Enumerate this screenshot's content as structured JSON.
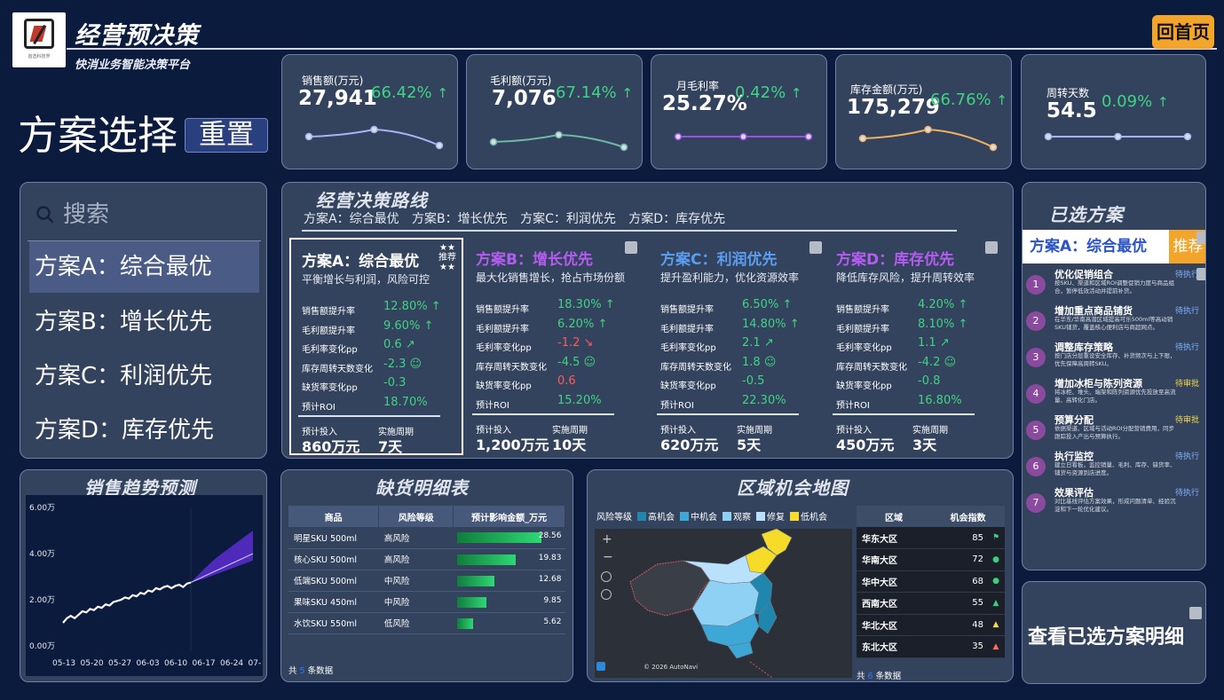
{
  "header": {
    "app_title": "经营预决策",
    "app_subtitle": "快消业务智能决策平台",
    "logo_caption": "首选科技界",
    "home_button": "回首页"
  },
  "scheme_select": {
    "title": "方案选择",
    "reset": "重置",
    "search_placeholder": "搜索",
    "items": [
      "方案A：综合最优",
      "方案B：增长优先",
      "方案C：利润优先",
      "方案D：库存优先"
    ],
    "active_index": 0
  },
  "kpis": [
    {
      "name": "销售额(万元)",
      "value": "27,941",
      "pct": "66.42%",
      "color": "#a6b4f2",
      "points": [
        0.5,
        0.7,
        0.25
      ]
    },
    {
      "name": "毛利额(万元)",
      "value": "7,076",
      "pct": "67.14%",
      "color": "#6fb8a7",
      "points": [
        0.35,
        0.55,
        0.2
      ]
    },
    {
      "name": "月毛利率",
      "value": "25.27%",
      "pct": "0.42%",
      "color": "#9d4de8",
      "points": [
        0.5,
        0.5,
        0.5
      ]
    },
    {
      "name": "库存金额(万元)",
      "value": "175,279",
      "pct": "66.76%",
      "color": "#f1b160",
      "points": [
        0.45,
        0.7,
        0.2
      ]
    },
    {
      "name": "周转天数",
      "value": "54.5",
      "pct": "0.09%",
      "color": "#a6b4f2",
      "points": [
        0.5,
        0.5,
        0.5
      ]
    }
  ],
  "route": {
    "title": "经营决策路线",
    "legend": "方案A：综合最优 方案B：增长优先 方案C：利润优先 方案D：库存优先",
    "recommend_badge": "推荐",
    "cards": [
      {
        "name": "方案A：综合最优",
        "desc": "平衡增长与利润，风险可控",
        "name_color": "#ffffff",
        "metrics": [
          {
            "label": "销售额提升率",
            "value": "12.80%",
            "icon": "↑",
            "color": "#3fd384"
          },
          {
            "label": "毛利额提升率",
            "value": "9.60%",
            "icon": "↑",
            "color": "#3fd384"
          },
          {
            "label": "毛利率变化pp",
            "value": "0.6",
            "icon": "↗",
            "color": "#3fd384"
          },
          {
            "label": "库存周转天数变化",
            "value": "-2.3",
            "icon": "☺",
            "color": "#3fd384"
          },
          {
            "label": "缺货率变化pp",
            "value": "-0.3",
            "icon": "",
            "color": "#3fd384"
          },
          {
            "label": "预计ROI",
            "value": "18.70%",
            "icon": "",
            "color": "#3fd384"
          }
        ],
        "invest_label": "预计投入",
        "invest": "860万元",
        "period_label": "实施周期",
        "period": "7天"
      },
      {
        "name": "方案B：增长优先",
        "desc": "最大化销售增长，抢占市场份额",
        "name_color": "#b45cf0",
        "metrics": [
          {
            "label": "销售额提升率",
            "value": "18.30%",
            "icon": "↑",
            "color": "#3fd384"
          },
          {
            "label": "毛利额提升率",
            "value": "6.20%",
            "icon": "↑",
            "color": "#3fd384"
          },
          {
            "label": "毛利率变化pp",
            "value": "-1.2",
            "icon": "↘",
            "color": "#ff5a5a"
          },
          {
            "label": "库存周转天数变化",
            "value": "-4.5",
            "icon": "☺",
            "color": "#3fd384"
          },
          {
            "label": "缺货率变化pp",
            "value": "0.6",
            "icon": "",
            "color": "#ff5a5a"
          },
          {
            "label": "预计ROI",
            "value": "15.20%",
            "icon": "",
            "color": "#3fd384"
          }
        ],
        "invest_label": "预计投入",
        "invest": "1,200万元",
        "period_label": "实施周期",
        "period": "10天"
      },
      {
        "name": "方案C：利润优先",
        "desc": "提升盈利能力，优化资源效率",
        "name_color": "#5a9cf0",
        "metrics": [
          {
            "label": "销售额提升率",
            "value": "6.50%",
            "icon": "↑",
            "color": "#3fd384"
          },
          {
            "label": "毛利额提升率",
            "value": "14.80%",
            "icon": "↑",
            "color": "#3fd384"
          },
          {
            "label": "毛利率变化pp",
            "value": "2.1",
            "icon": "↗",
            "color": "#3fd384"
          },
          {
            "label": "库存周转天数变化",
            "value": "1.8",
            "icon": "☺",
            "color": "#3fd384"
          },
          {
            "label": "缺货率变化pp",
            "value": "-0.5",
            "icon": "",
            "color": "#3fd384"
          },
          {
            "label": "预计ROI",
            "value": "22.30%",
            "icon": "",
            "color": "#3fd384"
          }
        ],
        "invest_label": "预计投入",
        "invest": "620万元",
        "period_label": "实施周期",
        "period": "5天"
      },
      {
        "name": "方案D：库存优先",
        "desc": "降低库存风险，提升周转效率",
        "name_color": "#b45cf0",
        "metrics": [
          {
            "label": "销售额提升率",
            "value": "4.20%",
            "icon": "↑",
            "color": "#3fd384"
          },
          {
            "label": "毛利额提升率",
            "value": "8.10%",
            "icon": "↑",
            "color": "#3fd384"
          },
          {
            "label": "毛利率变化pp",
            "value": "1.1",
            "icon": "↗",
            "color": "#3fd384"
          },
          {
            "label": "库存周转天数变化",
            "value": "-4.2",
            "icon": "☺",
            "color": "#3fd384"
          },
          {
            "label": "缺货率变化pp",
            "value": "-0.8",
            "icon": "",
            "color": "#3fd384"
          },
          {
            "label": "预计ROI",
            "value": "16.80%",
            "icon": "",
            "color": "#3fd384"
          }
        ],
        "invest_label": "预计投入",
        "invest": "450万元",
        "period_label": "实施周期",
        "period": "3天"
      }
    ]
  },
  "selected": {
    "title": "已选方案",
    "scheme": "方案A：综合最优",
    "tag": "推荐",
    "steps": [
      {
        "n": "1",
        "title": "优化促销组合",
        "desc": "按SKU、渠道和区域ROI调整促销力度与商品组合，暂停低效活动并提前补货。",
        "status": "待执行"
      },
      {
        "n": "2",
        "title": "增加重点商品铺货",
        "desc": "在华东/华南高潜区域提高可乐500ml等高动销SKU铺货，覆盖核心便利店与商超网点。",
        "status": "待执行"
      },
      {
        "n": "3",
        "title": "调整库存策略",
        "desc": "按门店分层重设安全库存、补货频次与上下限，优先保障高周转SKU。",
        "status": "待执行"
      },
      {
        "n": "4",
        "title": "增加冰柜与陈列资源",
        "desc": "将冰柜、堆头、端架和陈列资源优先投放至高流量、高转化门店。",
        "status": "待审批"
      },
      {
        "n": "5",
        "title": "预算分配",
        "desc": "依据渠道、区域与活动ROI分配营销费用，同步跟踪投入产出与预算执行。",
        "status": "待审批"
      },
      {
        "n": "6",
        "title": "执行监控",
        "desc": "建立日看板，监控销量、毛利、库存、缺货率、铺货与资源到店进度。",
        "status": "待执行"
      },
      {
        "n": "7",
        "title": "效果评估",
        "desc": "对比基线评估方案效果，形成问题清单、经验沉淀和下一轮优化建议。",
        "status": "待执行"
      }
    ],
    "view_details": "查看已选方案明细"
  },
  "trend": {
    "title": "销售趋势预测"
  },
  "chart_data": {
    "type": "line",
    "title": "销售趋势预测",
    "xlabel": "",
    "ylabel": "",
    "y_ticks": [
      "0.00万",
      "2.00万",
      "4.00万",
      "6.00万"
    ],
    "x_ticks": [
      "05-13",
      "05-20",
      "05-27",
      "06-03",
      "06-10",
      "06-17",
      "06-24",
      "07-"
    ],
    "ylim": [
      0,
      6
    ],
    "series": [
      {
        "values": [
          1.0,
          1.2,
          1.3,
          1.2,
          1.35,
          1.5,
          1.45,
          1.6,
          1.55,
          1.7,
          1.65,
          1.8,
          1.75,
          1.9,
          1.95,
          2.0,
          2.1,
          2.05,
          2.2,
          2.15,
          2.3,
          2.25,
          2.4,
          2.35,
          2.5,
          2.45,
          2.55,
          2.6,
          2.5,
          2.6,
          2.65,
          2.55,
          2.7,
          2.75
        ]
      },
      {
        "values": [
          2.75,
          3.0,
          3.25,
          3.5,
          3.75,
          4.0
        ],
        "forecast": true
      },
      {
        "values": [
          2.75,
          3.3,
          3.8,
          4.2,
          4.6,
          5.0
        ],
        "band": "upper"
      },
      {
        "values": [
          2.75,
          2.9,
          3.1,
          3.3,
          3.5,
          3.7
        ],
        "band": "lower"
      }
    ]
  },
  "oos": {
    "title": "缺货明细表",
    "headers": [
      "商品",
      "风险等级",
      "预计影响金额_万元"
    ],
    "rows": [
      {
        "name": "明星SKU 500ml",
        "risk": "高风险",
        "level": "high",
        "amount": "28.56",
        "v": 28.56
      },
      {
        "name": "核心SKU 500ml",
        "risk": "高风险",
        "level": "high",
        "amount": "19.83",
        "v": 19.83
      },
      {
        "name": "低端SKU 500ml",
        "risk": "中风险",
        "level": "mid",
        "amount": "12.68",
        "v": 12.68
      },
      {
        "name": "果味SKU 450ml",
        "risk": "中风险",
        "level": "mid",
        "amount": "9.85",
        "v": 9.85
      },
      {
        "name": "水饮SKU 550ml",
        "risk": "低风险",
        "level": "low",
        "amount": "5.62",
        "v": 5.62
      }
    ],
    "footer_pre": "共",
    "footer_num": "5",
    "footer_post": "条数据"
  },
  "map": {
    "title": "区域机会地图",
    "legend_title": "风险等级",
    "legend": [
      {
        "label": "高机会",
        "color": "#1f86ae"
      },
      {
        "label": "中机会",
        "color": "#3da7d6"
      },
      {
        "label": "观察",
        "color": "#8fd0f5"
      },
      {
        "label": "修复",
        "color": "#b9e1fb"
      },
      {
        "label": "低机会",
        "color": "#f6dc28"
      }
    ],
    "attribution": "© 2026 AutoNavi",
    "region_headers": [
      "区域",
      "机会指数"
    ],
    "regions": [
      {
        "name": "华东大区",
        "value": "85",
        "icon": "⚑",
        "color": "#3fcf7a"
      },
      {
        "name": "华南大区",
        "value": "72",
        "icon": "●",
        "color": "#3fcf7a"
      },
      {
        "name": "华中大区",
        "value": "68",
        "icon": "●",
        "color": "#3fcf7a"
      },
      {
        "name": "西南大区",
        "value": "55",
        "icon": "▲",
        "color": "#3fcf7a"
      },
      {
        "name": "华北大区",
        "value": "48",
        "icon": "▲",
        "color": "#f6d84a"
      },
      {
        "name": "东北大区",
        "value": "35",
        "icon": "▲",
        "color": "#ff6a5a"
      }
    ],
    "footer_pre": "共",
    "footer_num": "6",
    "footer_post": "条数据"
  }
}
